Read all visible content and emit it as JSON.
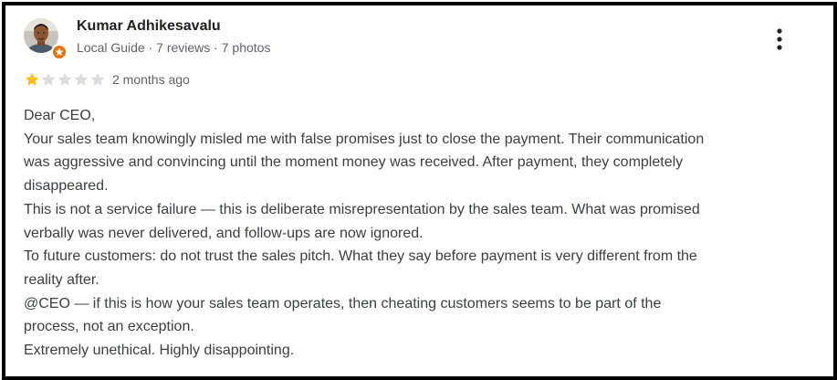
{
  "reviewer": {
    "name": "Kumar Adhikesavalu",
    "meta": "Local Guide · 7 reviews · 7 photos",
    "avatar": "profile-photo",
    "badge_icon": "local-guide-star-icon"
  },
  "menu": {
    "icon": "more-vertical-icon"
  },
  "rating": {
    "stars": 1,
    "max_stars": 5,
    "filled_color": "#fbbc04",
    "empty_color": "#dadce0",
    "date": "2 months ago"
  },
  "review": {
    "lines": [
      "Dear CEO,",
      "Your sales team knowingly misled me with false promises just to close the payment. Their communication",
      "was aggressive and convincing until the moment money was received. After payment, they completely",
      "disappeared.",
      "This is not a service failure — this is deliberate misrepresentation by the sales team. What was promised",
      "verbally was never delivered, and follow-ups are now ignored.",
      "To future customers: do not trust the sales pitch. What they say before payment is very different from the",
      "reality after.",
      "@CEO — if this is how your sales team operates, then cheating customers seems to be part of the",
      "process, not an exception.",
      "Extremely unethical. Highly disappointing."
    ]
  }
}
